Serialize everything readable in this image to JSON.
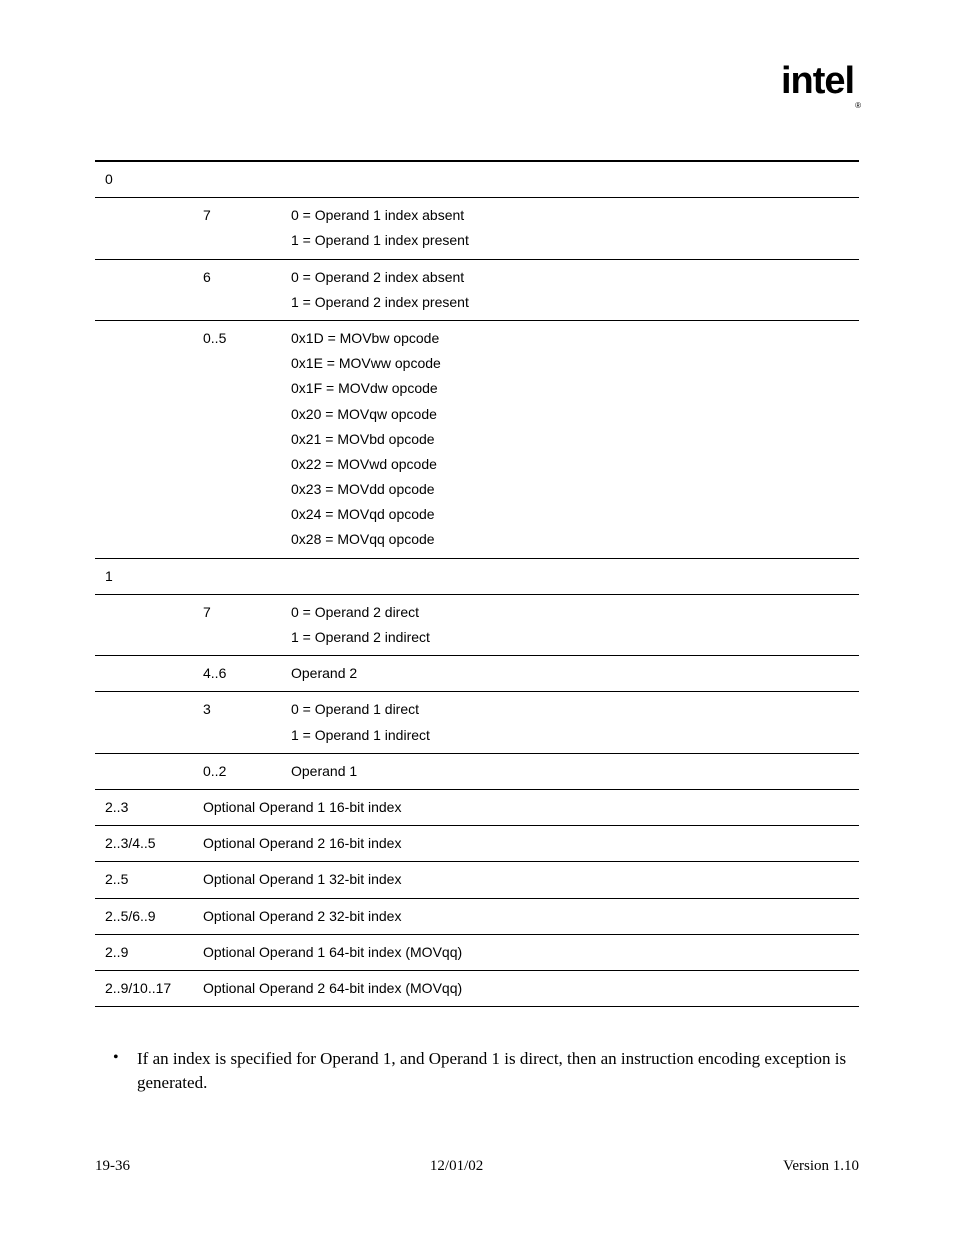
{
  "logo": "intel",
  "logo_sub": "®",
  "table": {
    "rows": [
      {
        "c1": "0",
        "c2": "",
        "c3": ""
      },
      {
        "c1": "",
        "c2": "7",
        "c3": "0 = Operand 1 index absent\n1 = Operand 1 index present"
      },
      {
        "c1": "",
        "c2": "6",
        "c3": "0 = Operand 2 index absent\n1 = Operand 2 index present"
      },
      {
        "c1": "",
        "c2": "0..5",
        "c3": "0x1D = MOVbw opcode\n0x1E = MOVww opcode\n0x1F = MOVdw opcode\n0x20 = MOVqw opcode\n0x21 = MOVbd opcode\n0x22 = MOVwd opcode\n0x23 = MOVdd opcode\n0x24 = MOVqd opcode\n0x28 = MOVqq opcode"
      },
      {
        "c1": "1",
        "c2": "",
        "c3": ""
      },
      {
        "c1": "",
        "c2": "7",
        "c3": "0 = Operand 2 direct\n1 = Operand 2 indirect"
      },
      {
        "c1": "",
        "c2": "4..6",
        "c3": "Operand 2"
      },
      {
        "c1": "",
        "c2": "3",
        "c3": "0 = Operand 1 direct\n1 = Operand 1 indirect"
      },
      {
        "c1": "",
        "c2": "0..2",
        "c3": "Operand 1"
      },
      {
        "c1": "2..3",
        "span23": "Optional Operand 1 16-bit index"
      },
      {
        "c1": "2..3/4..5",
        "span23": "Optional Operand 2 16-bit index"
      },
      {
        "c1": "2..5",
        "span23": "Optional Operand 1 32-bit index"
      },
      {
        "c1": "2..5/6..9",
        "span23": "Optional Operand 2 32-bit index"
      },
      {
        "c1": "2..9",
        "span23": "Optional Operand 1 64-bit index (MOVqq)"
      },
      {
        "c1": "2..9/10..17",
        "span23": "Optional Operand 2 64-bit index (MOVqq)"
      }
    ]
  },
  "bullet": "If an index is specified for Operand 1, and Operand 1 is direct, then an instruction encoding exception is generated.",
  "footer": {
    "left": "19-36",
    "center": "12/01/02",
    "right": "Version 1.10"
  }
}
